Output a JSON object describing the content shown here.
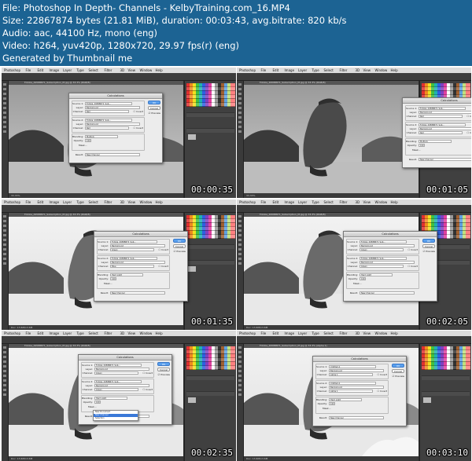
{
  "header": {
    "lines": [
      "File: Photoshop In Depth- Channels - KelbyTraining.com_16.MP4",
      "Size: 22867874 bytes (21.81 MiB), duration: 00:03:43, avg.bitrate: 820 kb/s",
      "Audio: aac, 44100 Hz, mono (eng)",
      "Video: h264, yuv420p, 1280x720, 29.97 fps(r) (eng)",
      "Generated by Thumbnail me"
    ]
  },
  "app": {
    "menu": [
      "Photoshop",
      "File",
      "Edit",
      "Image",
      "Layer",
      "Type",
      "Select",
      "Filter",
      "3D",
      "View",
      "Window",
      "Help"
    ]
  },
  "thumbnails": [
    {
      "timecode": "00:00:35",
      "doc_title": "Fotolia_29588871_Subscription_M.jpg @ 33.3% (RGB/8)",
      "status": "33.33%",
      "dialog": {
        "title": "Calculations",
        "source1_label": "Source 1:",
        "source1_value": "Fotolia_29588871_Sub...",
        "layer_label": "Layer:",
        "layer1_value": "Background",
        "channel_label": "Channel:",
        "channel1_value": "Red",
        "source2_label": "Source 2:",
        "source2_value": "Fotolia_29588871_Sub...",
        "layer2_value": "Background",
        "channel2_value": "Red",
        "blending_label": "Blending:",
        "blending_value": "Multiply",
        "opacity_label": "Opacity:",
        "opacity_value": "100",
        "mask_label": "Mask...",
        "result_label": "Result:",
        "result_value": "New Channel",
        "ok": "OK",
        "cancel": "Cancel",
        "preview": "Preview",
        "invert": "Invert"
      }
    },
    {
      "timecode": "00:01:05",
      "doc_title": "Fotolia_29588871_Subscription_M.jpg @ 33.3% (RGB/8)",
      "status": "33.33%",
      "dialog": {
        "title": "Calculations",
        "source1_label": "Source 1:",
        "source1_value": "Fotolia_29588871_Sub...",
        "layer_label": "Layer:",
        "layer1_value": "Background",
        "channel_label": "Channel:",
        "channel1_value": "Red",
        "source2_label": "Source 2:",
        "source2_value": "Fotolia_29588871_Sub...",
        "layer2_value": "Background",
        "channel2_value": "Red",
        "blending_label": "Blending:",
        "blending_value": "Multiply",
        "opacity_label": "Opacity:",
        "opacity_value": "100",
        "mask_label": "Mask...",
        "result_label": "Result:",
        "result_value": "New Channel",
        "ok": "OK",
        "cancel": "Cancel",
        "preview": "Preview",
        "invert": "Invert"
      }
    },
    {
      "timecode": "00:01:35",
      "doc_title": "Fotolia_29588871_Subscription_M.jpg @ 33.3% (RGB/8)",
      "status": "Doc: 13.6M/13.6M",
      "dialog": {
        "title": "Calculations",
        "source1_label": "Source 1:",
        "source1_value": "Fotolia_29588871_Sub...",
        "layer_label": "Layer:",
        "layer1_value": "Background",
        "channel_label": "Channel:",
        "channel1_value": "Green",
        "source2_label": "Source 2:",
        "source2_value": "Fotolia_29588871_Sub...",
        "layer2_value": "Background",
        "channel2_value": "Blue",
        "blending_label": "Blending:",
        "blending_value": "Hard Light",
        "opacity_label": "Opacity:",
        "opacity_value": "100",
        "mask_label": "Mask...",
        "result_label": "Result:",
        "result_value": "New Channel",
        "ok": "OK",
        "cancel": "Cancel",
        "preview": "Preview",
        "invert": "Invert"
      }
    },
    {
      "timecode": "00:02:05",
      "doc_title": "Fotolia_29588871_Subscription_M.jpg @ 33.3% (RGB/8)",
      "status": "Doc: 13.6M/13.6M",
      "dialog": {
        "title": "Calculations",
        "source1_label": "Source 1:",
        "source1_value": "Fotolia_29588871_Sub...",
        "layer_label": "Layer:",
        "layer1_value": "Background",
        "channel_label": "Channel:",
        "channel1_value": "Green",
        "source2_label": "Source 2:",
        "source2_value": "Fotolia_29588871_Sub...",
        "layer2_value": "Background",
        "channel2_value": "Green",
        "blending_label": "Blending:",
        "blending_value": "Hard Light",
        "opacity_label": "Opacity:",
        "opacity_value": "100",
        "mask_label": "Mask...",
        "result_label": "Result:",
        "result_value": "New Channel",
        "ok": "OK",
        "cancel": "Cancel",
        "preview": "Preview",
        "invert": "Invert"
      }
    },
    {
      "timecode": "00:02:35",
      "doc_title": "Fotolia_29588871_Subscription_M.jpg @ 33.3% (RGB/8)",
      "status": "Doc: 13.6M/13.6M",
      "dialog": {
        "title": "Calculations",
        "source1_label": "Source 1:",
        "source1_value": "Fotolia_29588871_Sub...",
        "layer_label": "Layer:",
        "layer1_value": "Background",
        "channel_label": "Channel:",
        "channel1_value": "Green",
        "source2_label": "Source 2:",
        "source2_value": "Fotolia_29588871_Sub...",
        "layer2_value": "Background",
        "channel2_value": "Green",
        "blending_label": "Blending:",
        "blending_value": "Hard Light",
        "opacity_label": "Opacity:",
        "opacity_value": "100",
        "mask_label": "Mask...",
        "result_label": "Result:",
        "result_value": "New Channel",
        "ok": "OK",
        "cancel": "Cancel",
        "preview": "Preview",
        "invert": "Invert",
        "popup": [
          "New Document",
          "New Channel",
          "Selection"
        ],
        "popup_selected": 1
      }
    },
    {
      "timecode": "00:03:10",
      "doc_title": "Fotolia_29588871_Subscription_M.jpg @ 33.3% (Alpha 1)",
      "status": "Doc: 13.6M/13.6M",
      "dialog": {
        "title": "Calculations",
        "source1_label": "Source 1:",
        "source1_value": "Untitled-1",
        "layer_label": "Layer:",
        "layer1_value": "Background",
        "channel_label": "Channel:",
        "channel1_value": "Alpha 1",
        "source2_label": "Source 2:",
        "source2_value": "Untitled-1",
        "layer2_value": "Background",
        "channel2_value": "Alpha 1",
        "blending_label": "Blending:",
        "blending_value": "Hard Light",
        "opacity_label": "Opacity:",
        "opacity_value": "100",
        "mask_label": "Mask...",
        "result_label": "Result:",
        "result_value": "New Channel",
        "ok": "OK",
        "cancel": "Cancel",
        "preview": "Preview",
        "invert": "Invert"
      }
    }
  ]
}
